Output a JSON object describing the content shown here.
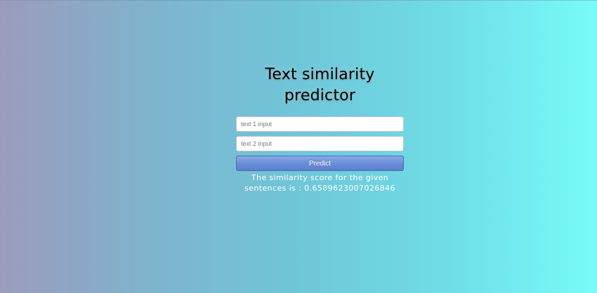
{
  "header": {
    "title": "Text similarity predictor"
  },
  "form": {
    "text1": {
      "value": "",
      "placeholder": "text 1 input"
    },
    "text2": {
      "value": "",
      "placeholder": "text 2 input"
    },
    "predict_label": "Predict"
  },
  "result": {
    "text": "The similarity score for the given sentences is : 0.6589623007026846"
  },
  "colors": {
    "background_left": "#9c9bbd",
    "background_right": "#78fbf7",
    "button": "#6a8fd8",
    "result_text": "#ffffff"
  }
}
